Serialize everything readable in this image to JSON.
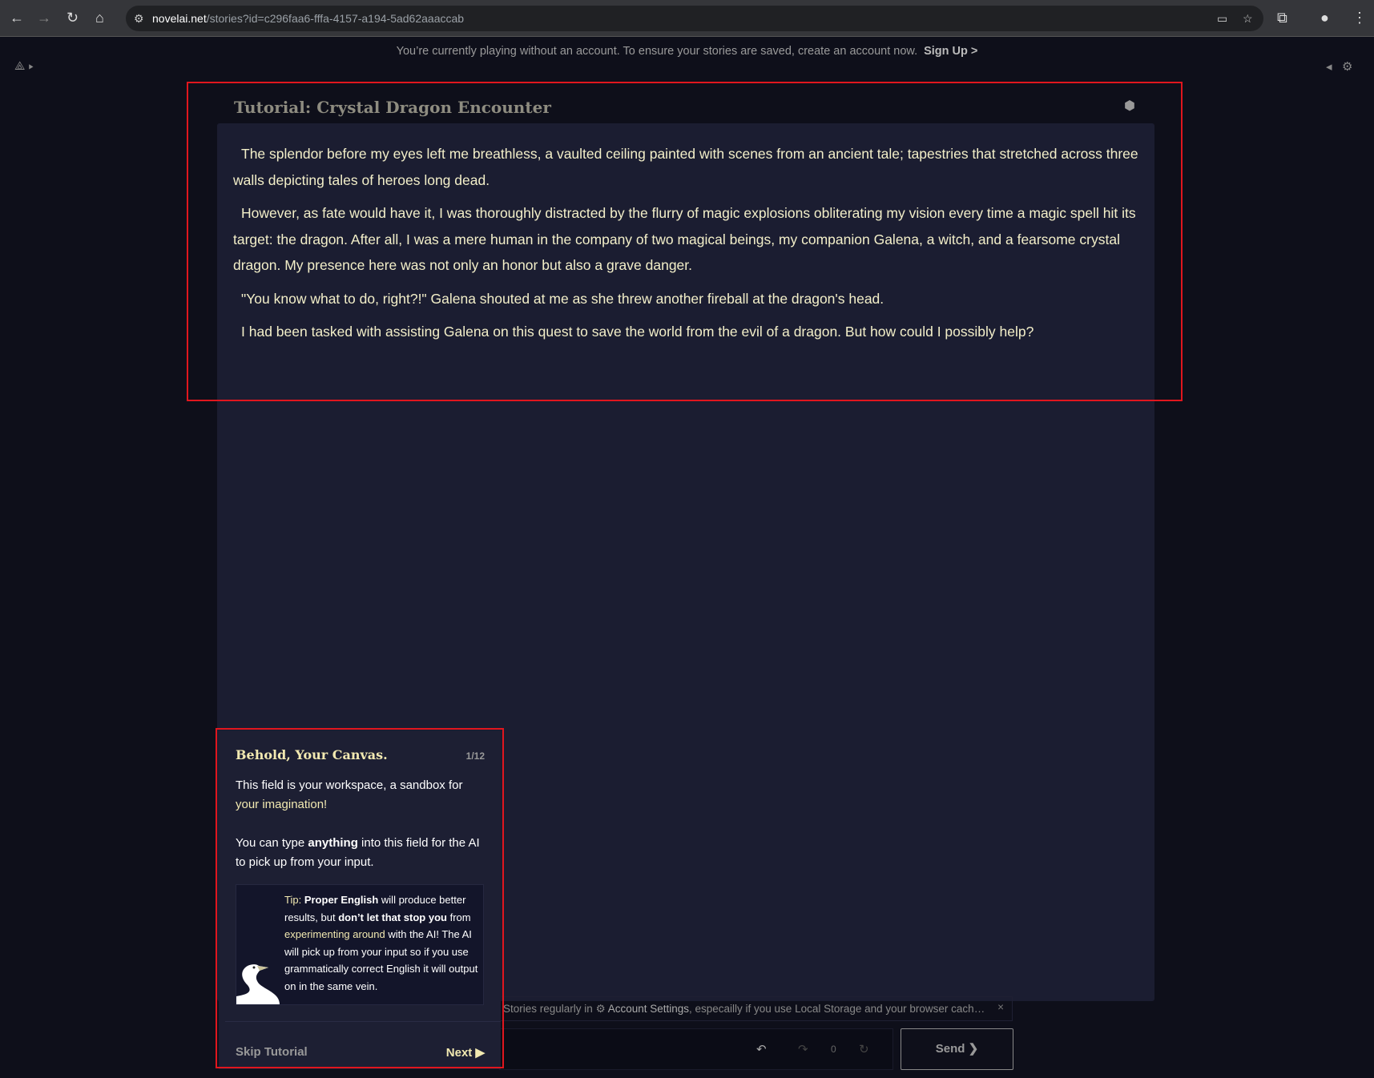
{
  "browser": {
    "domain": "novelai.net",
    "path": "/stories?id=c296faa6-fffa-4157-a194-5ad62aaaccab"
  },
  "banner": {
    "text": "You’re currently playing without an account. To ensure your stories are saved, create an account now.",
    "link": "Sign Up >"
  },
  "story": {
    "title": "Tutorial: Crystal Dragon Encounter",
    "paragraphs": [
      "The splendor before my eyes left me breathless, a vaulted ceiling painted with scenes from an ancient tale; tapestries that stretched across three walls depicting tales of heroes long dead.",
      "However, as fate would have it, I was thoroughly distracted by the flurry of magic explosions obliterating my vision every time a magic spell hit its target: the dragon. After all, I was a mere human in the company of two magical beings, my companion Galena, a witch, and a fearsome crystal dragon. My presence here was not only an honor but also a grave danger.",
      "\"You know what to do, right?!\" Galena shouted at me as she threw another fireball at the dragon's head.",
      "I had been tasked with assisting Galena on this quest to save the world from the evil of a dragon. But how could I possibly help?"
    ]
  },
  "tutorial": {
    "title": "Behold, Your Canvas.",
    "step": "1/12",
    "p1a": "This field is your workspace, a sandbox for ",
    "p1b": "your imagination!",
    "p2a": "You can type ",
    "p2b": "anything",
    "p2c": " into this field for the AI to pick up from your input.",
    "tip": {
      "label": "Tip:",
      "b1": "Proper English",
      "t1": " will produce better results, but ",
      "b2": "don’t let that stop you",
      "t2": " from ",
      "y1": "experimenting around",
      "t3": " with the AI! The AI will pick up from your input so if you use grammatically correct English it will output on in the same vein."
    },
    "skip": "Skip Tutorial",
    "next": "Next"
  },
  "notice": {
    "pre": "Stories regularly in",
    "link": "Account Settings",
    "post": ", especailly if you use Local Storage and your browser cach…",
    "close": "×"
  },
  "controls": {
    "retry_count": "0",
    "send": "Send"
  }
}
